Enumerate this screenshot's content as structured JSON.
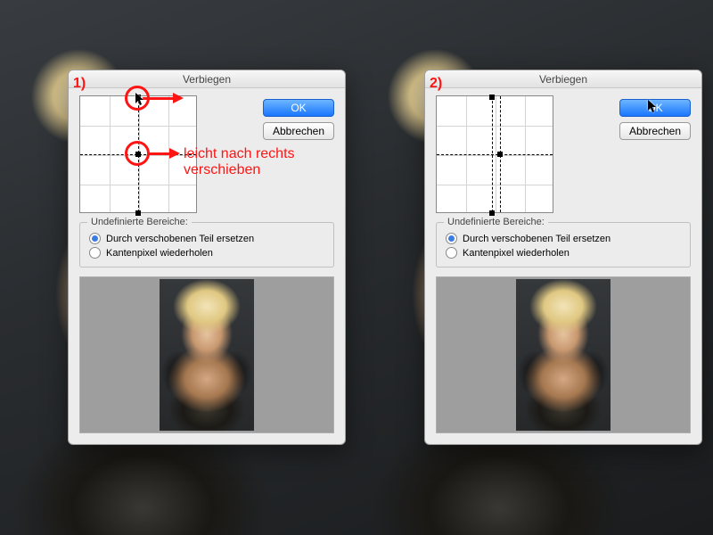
{
  "step_labels": {
    "left": "1)",
    "right": "2)"
  },
  "dialog": {
    "title": "Verbiegen",
    "ok_label": "OK",
    "cancel_label": "Abbrechen",
    "group_title": "Undefinierte Bereiche:",
    "radio_replace": "Durch verschobenen Teil ersetzen",
    "radio_repeat": "Kantenpixel wiederholen"
  },
  "annotations": {
    "line1": "leicht nach rechts",
    "line2": "verschieben"
  }
}
